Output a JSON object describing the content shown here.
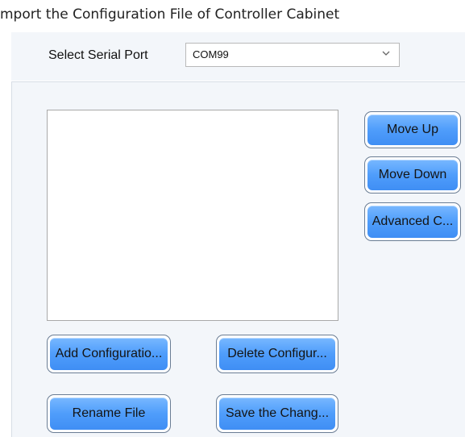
{
  "window": {
    "title": "mport the Configuration File of Controller Cabinet"
  },
  "serial_port": {
    "label": "Select Serial Port",
    "selected": "COM99"
  },
  "config_list": {
    "items": []
  },
  "buttons": {
    "move_up": "Move Up",
    "move_down": "Move Down",
    "advanced": "Advanced C...",
    "add": "Add Configuratio...",
    "delete": "Delete Configur...",
    "rename": "Rename File",
    "save": "Save the Chang..."
  },
  "icons": {
    "dropdown": "chevron-down-icon"
  },
  "colors": {
    "button_fill": "#4f9dfb",
    "panel_bg": "#f3f6fa"
  }
}
